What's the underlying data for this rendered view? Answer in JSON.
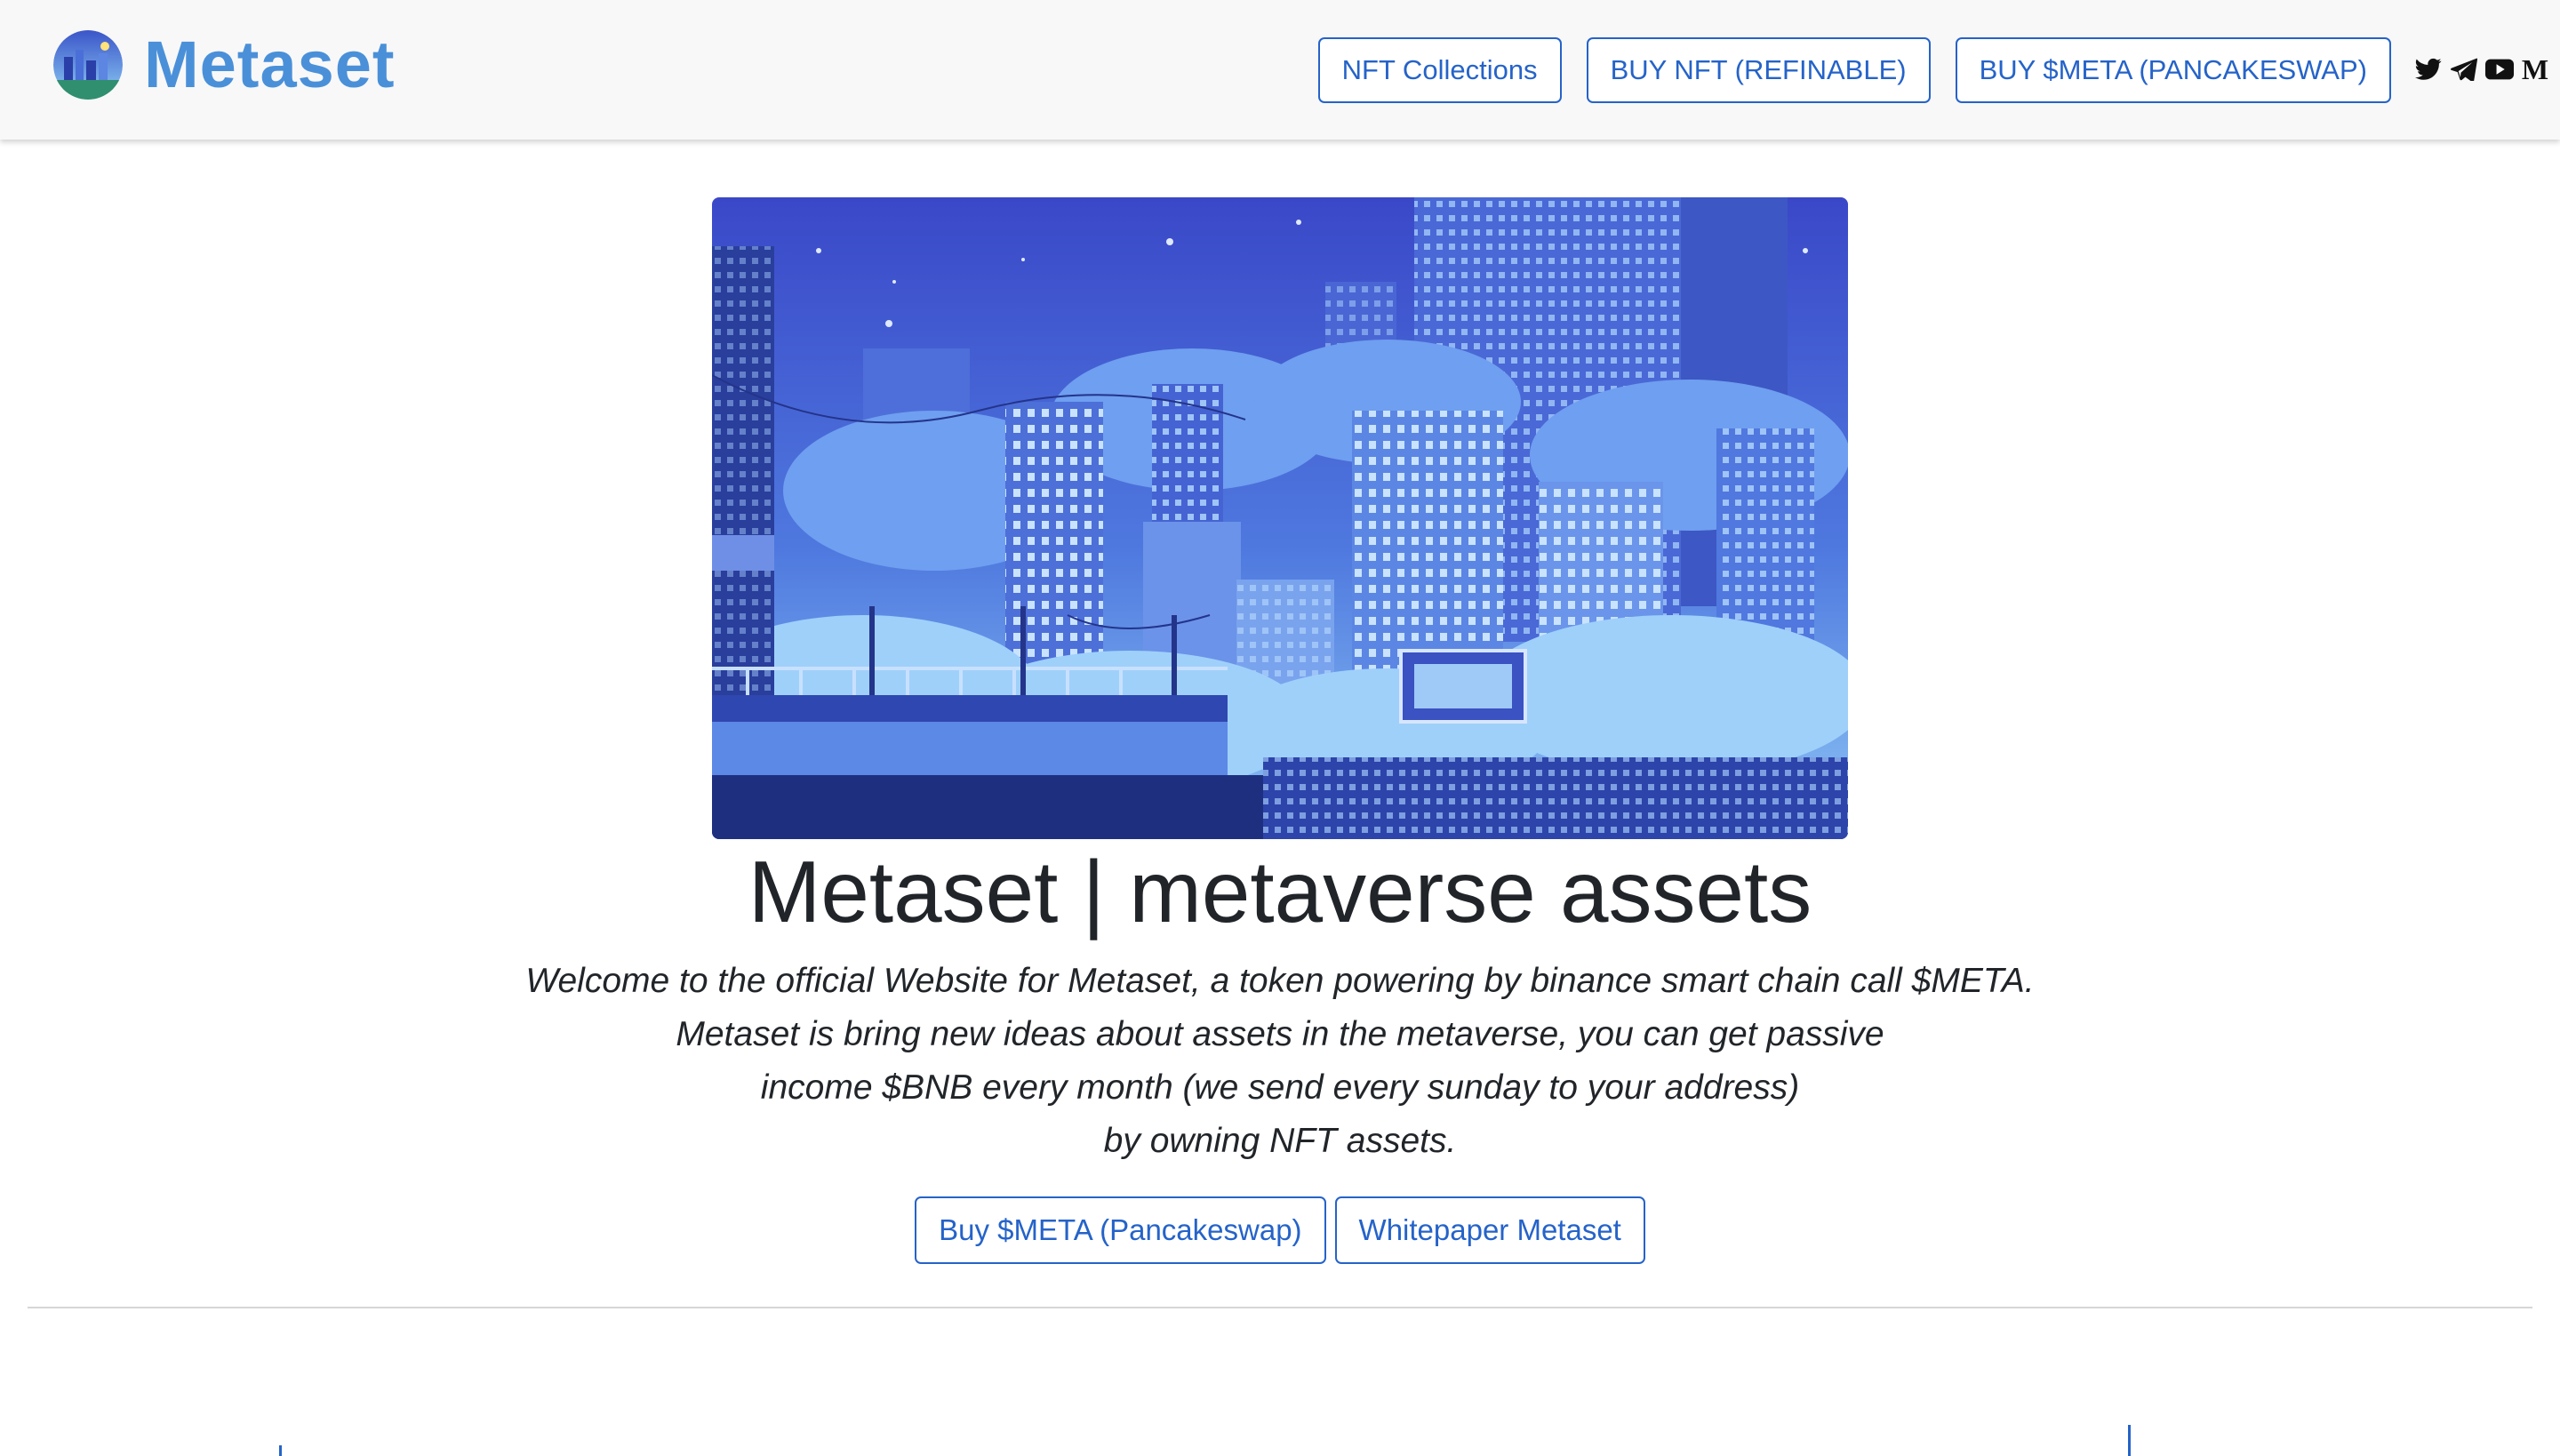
{
  "nav": {
    "brand": "Metaset",
    "buttons": [
      "NFT Collections",
      "BUY NFT (REFINABLE)",
      "BUY $META (PANCAKESWAP)"
    ],
    "social_icons": [
      "twitter-icon",
      "telegram-icon",
      "youtube-icon",
      "medium-icon"
    ],
    "medium_glyph": "M"
  },
  "hero": {
    "title": "Metaset | metaverse assets",
    "lines": [
      "Welcome to the official Website for Metaset, a token powering by binance smart chain call $META.",
      "Metaset is bring new ideas about assets in the metaverse, you can get passive",
      "income $BNB every month (we send every sunday to your address)",
      "by owning NFT assets."
    ],
    "buttons": [
      "Buy $META (Pancakeswap)",
      "Whitepaper Metaset"
    ]
  },
  "colors": {
    "accent": "#2563c9",
    "brand": "#4a90d9",
    "sky_top": "#3f4fd0",
    "sky_bottom": "#7fb6f2"
  }
}
